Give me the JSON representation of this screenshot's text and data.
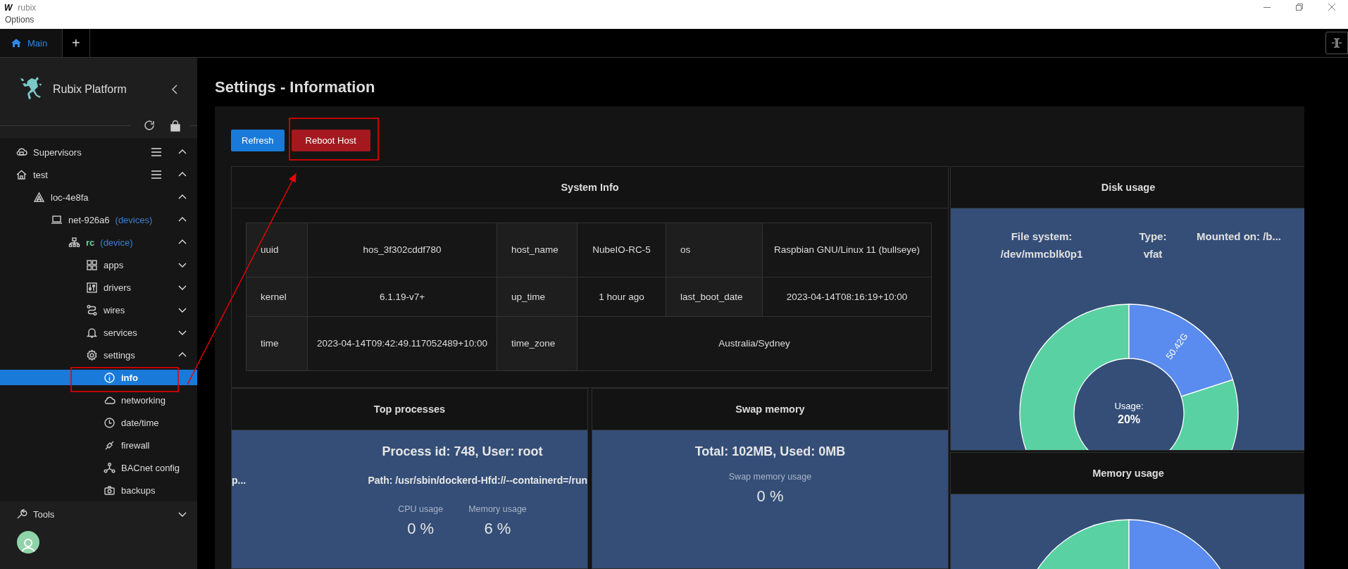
{
  "window": {
    "logo": "W",
    "title": "rubix",
    "menu": [
      "Options"
    ]
  },
  "tabs": [
    {
      "label": "Main",
      "kind": "home",
      "selected": true
    },
    {
      "label": "+",
      "kind": "add",
      "selected": false
    }
  ],
  "sidebar": {
    "brand": "Rubix Platform",
    "tree": [
      {
        "label": "Supervisors",
        "kind": "supervisors",
        "menu": true,
        "expanded": true,
        "selected": false
      },
      {
        "label": "test",
        "kind": "home",
        "menu": true,
        "expanded": true,
        "selected": false,
        "children": [
          {
            "label": "loc-4e8fa",
            "kind": "location",
            "expanded": true,
            "selected": false,
            "children": [
              {
                "label": "net-926a6",
                "suffix": "(devices)",
                "kind": "network",
                "expanded": true,
                "selected": false,
                "children": [
                  {
                    "label": "rc",
                    "suffix": "(device)",
                    "kind": "device",
                    "expanded": true,
                    "selected": false,
                    "children": [
                      {
                        "label": "apps",
                        "kind": "apps",
                        "expanded": false,
                        "selected": false
                      },
                      {
                        "label": "drivers",
                        "kind": "drivers",
                        "expanded": false,
                        "selected": false
                      },
                      {
                        "label": "wires",
                        "kind": "wires",
                        "expanded": false,
                        "selected": false
                      },
                      {
                        "label": "services",
                        "kind": "services",
                        "expanded": false,
                        "selected": false
                      },
                      {
                        "label": "settings",
                        "kind": "settings",
                        "expanded": true,
                        "selected": false,
                        "children": [
                          {
                            "label": "info",
                            "kind": "info",
                            "selected": true
                          },
                          {
                            "label": "networking",
                            "kind": "networking",
                            "selected": false
                          },
                          {
                            "label": "date/time",
                            "kind": "datetime",
                            "selected": false
                          },
                          {
                            "label": "firewall",
                            "kind": "firewall",
                            "selected": false
                          },
                          {
                            "label": "BACnet config",
                            "kind": "bacnet",
                            "selected": false
                          },
                          {
                            "label": "backups",
                            "kind": "backups",
                            "selected": false
                          }
                        ]
                      }
                    ]
                  }
                ]
              }
            ]
          }
        ]
      }
    ],
    "footer": [
      {
        "label": "Tools",
        "kind": "tools",
        "expanded": false,
        "selected": false
      }
    ]
  },
  "page": {
    "title": "Settings - Information",
    "buttons": [
      {
        "label": "Refresh",
        "kind": "primary"
      },
      {
        "label": "Reboot Host",
        "kind": "danger"
      }
    ],
    "system_info": {
      "title": "System Info",
      "rows": [
        [
          {
            "key": "uuid",
            "value": "hos_3f302cddf780"
          },
          {
            "key": "host_name",
            "value": "NubeIO-RC-5"
          },
          {
            "key": "os",
            "value": "Raspbian GNU/Linux 11 (bullseye)"
          }
        ],
        [
          {
            "key": "kernel",
            "value": "6.1.19-v7+"
          },
          {
            "key": "up_time",
            "value": "1 hour ago"
          },
          {
            "key": "last_boot_date",
            "value": "2023-04-14T08:16:19+10:00"
          }
        ],
        [
          {
            "key": "time",
            "value": "2023-04-14T09:42:49.117052489+10:00"
          },
          {
            "key": "time_zone",
            "value": "Australia/Sydney"
          }
        ]
      ]
    },
    "top_processes": {
      "title": "Top processes",
      "heading": "Process id: 748, User: root",
      "left_text": "p...",
      "path": "Path: /usr/sbin/dockerd-Hfd://--containerd=/run",
      "stats": [
        {
          "label": "CPU usage",
          "value": "0 %"
        },
        {
          "label": "Memory usage",
          "value": "6 %"
        }
      ]
    },
    "swap_memory": {
      "title": "Swap memory",
      "heading": "Total: 102MB, Used: 0MB",
      "stats": [
        {
          "label": "Swap memory usage",
          "value": "0 %"
        }
      ]
    },
    "disk_usage": {
      "title": "Disk usage",
      "fields": [
        "File system: /dev/mmcblk0p1",
        "Type: vfat",
        "Mounted on: /b..."
      ],
      "slice_label": "50.42G",
      "center_label": "Usage:",
      "center_value": "20%",
      "chart_data": {
        "type": "donut",
        "values": [
          20,
          80
        ]
      }
    },
    "memory_usage": {
      "title": "Memory usage"
    }
  }
}
